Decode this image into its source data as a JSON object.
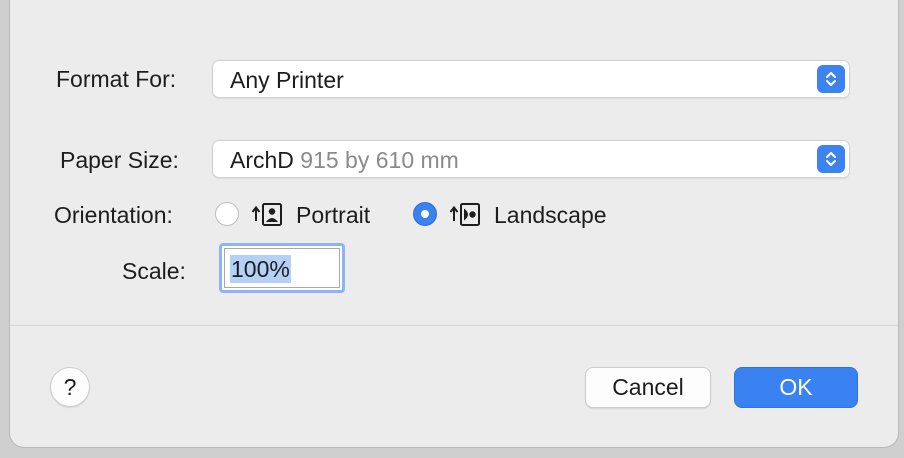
{
  "dialog": {
    "format_for": {
      "label": "Format For:",
      "value": "Any Printer"
    },
    "paper_size": {
      "label": "Paper Size:",
      "value_name": "ArchD",
      "value_detail": " 915 by 610 mm"
    },
    "orientation": {
      "label": "Orientation:",
      "options": [
        {
          "label": "Portrait",
          "selected": false
        },
        {
          "label": "Landscape",
          "selected": true
        }
      ]
    },
    "scale": {
      "label": "Scale:",
      "value": "100%"
    },
    "buttons": {
      "help": "?",
      "cancel": "Cancel",
      "ok": "OK"
    }
  },
  "colors": {
    "accent": "#3a82f2",
    "selection": "#b3d1f7"
  },
  "icons": [
    "chevron-updown-icon",
    "portrait-orientation-icon",
    "landscape-orientation-icon"
  ]
}
